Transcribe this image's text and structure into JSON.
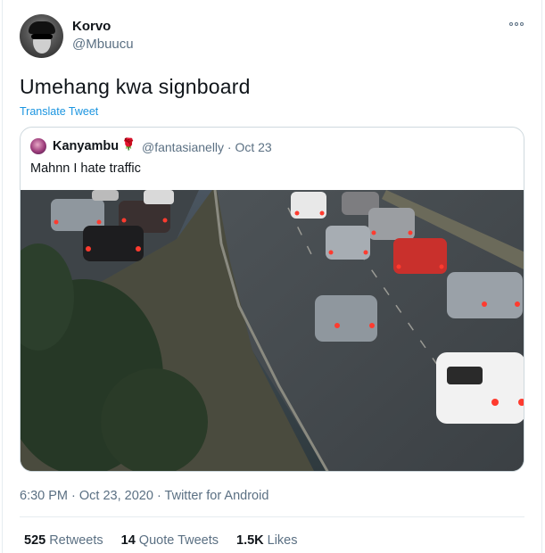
{
  "author": {
    "name": "Korvo",
    "handle": "@Mbuucu"
  },
  "tweet": {
    "text": "Umehang kwa signboard",
    "translate_label": "Translate Tweet"
  },
  "quoted": {
    "name": "Kanyambu",
    "rose_emoji": "🌹",
    "handle_date": "@fantasianelly · Oct 23",
    "text": "Mahnn I hate traffic"
  },
  "meta_line": "6:30 PM · Oct 23, 2020 · Twitter for Android",
  "stats": {
    "retweets_count": "525",
    "retweets_label": "Retweets",
    "quotes_count": "14",
    "quotes_label": "Quote Tweets",
    "likes_count": "1.5K",
    "likes_label": "Likes"
  },
  "icons": {
    "more": "more-options-icon"
  },
  "colors": {
    "link": "#1b95e0",
    "secondary_text": "#5b7083",
    "border": "#cfd9de"
  }
}
